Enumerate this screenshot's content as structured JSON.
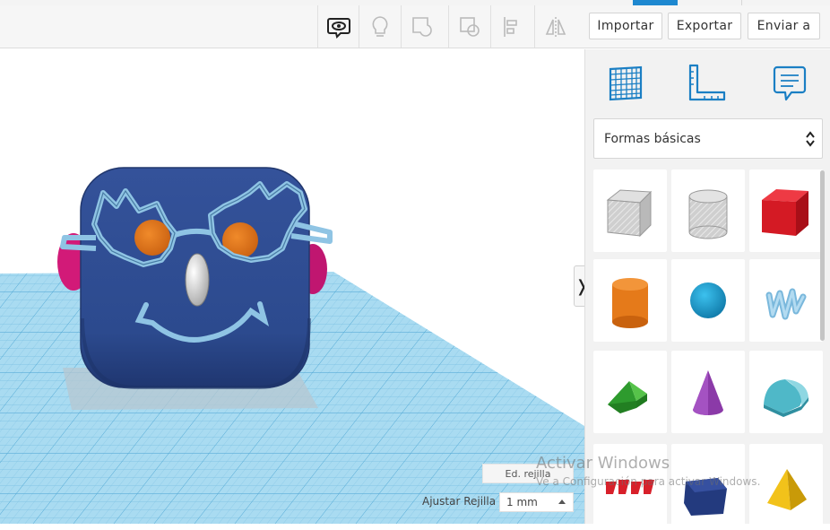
{
  "toolbar": {
    "icons": [
      "eye-comment-icon",
      "lightbulb-icon",
      "group-shape-icon",
      "ungroup-shape-icon",
      "align-icon",
      "mirror-icon"
    ],
    "buttons": {
      "import": "Importar",
      "export": "Exportar",
      "send": "Enviar a"
    }
  },
  "panel": {
    "tools": [
      "workplane-grid-icon",
      "ruler-icon",
      "notes-icon"
    ],
    "library": "Formas básicas",
    "shapes": [
      "box-hole",
      "cylinder-hole",
      "box",
      "cylinder",
      "sphere",
      "scribble",
      "roof",
      "cone",
      "round-roof",
      "text",
      "polygon",
      "pyramid"
    ]
  },
  "viewport": {
    "edit_grid": "Ed. rejilla",
    "snap_grid_label": "Ajustar Rejilla",
    "snap_grid_value": "1 mm"
  },
  "watermark": {
    "line1": "Activar Windows",
    "line2": "Ve a Configuración para activar Windows."
  },
  "colors": {
    "workplane": "#9ed4ee",
    "grid_line": "#6fb9de",
    "head": "#2e4a8e",
    "glasses": "#8fc4e4",
    "eyes": "#e0761e",
    "ears": "#d21a78",
    "accent": "#1e88d0"
  }
}
